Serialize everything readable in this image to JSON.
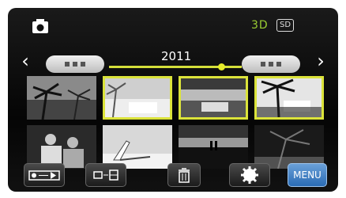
{
  "header": {
    "mode_label": "3D",
    "media_label": "SD"
  },
  "timeline": {
    "year": "2011",
    "slider_position": 0.82
  },
  "thumbnails": [
    {
      "row": 0,
      "col": 0,
      "selected": false,
      "icon": "palm-tree-photo-icon"
    },
    {
      "row": 0,
      "col": 1,
      "selected": true,
      "icon": "beach-photo-icon"
    },
    {
      "row": 0,
      "col": 2,
      "selected": true,
      "icon": "sea-horizon-photo-icon"
    },
    {
      "row": 0,
      "col": 3,
      "selected": true,
      "icon": "palm-silhouette-photo-icon"
    },
    {
      "row": 1,
      "col": 0,
      "selected": false,
      "icon": "people-photo-icon"
    },
    {
      "row": 1,
      "col": 1,
      "selected": false,
      "icon": "beach-chair-photo-icon"
    },
    {
      "row": 1,
      "col": 2,
      "selected": false,
      "icon": "sunset-couple-photo-icon"
    },
    {
      "row": 1,
      "col": 3,
      "selected": false,
      "icon": "tree-photo-icon"
    }
  ],
  "toolbar": {
    "menu_label": "MENU"
  },
  "colors": {
    "accent": "#dbe33a",
    "mode3d": "#9acd32",
    "menu": "#2a6bb4"
  }
}
